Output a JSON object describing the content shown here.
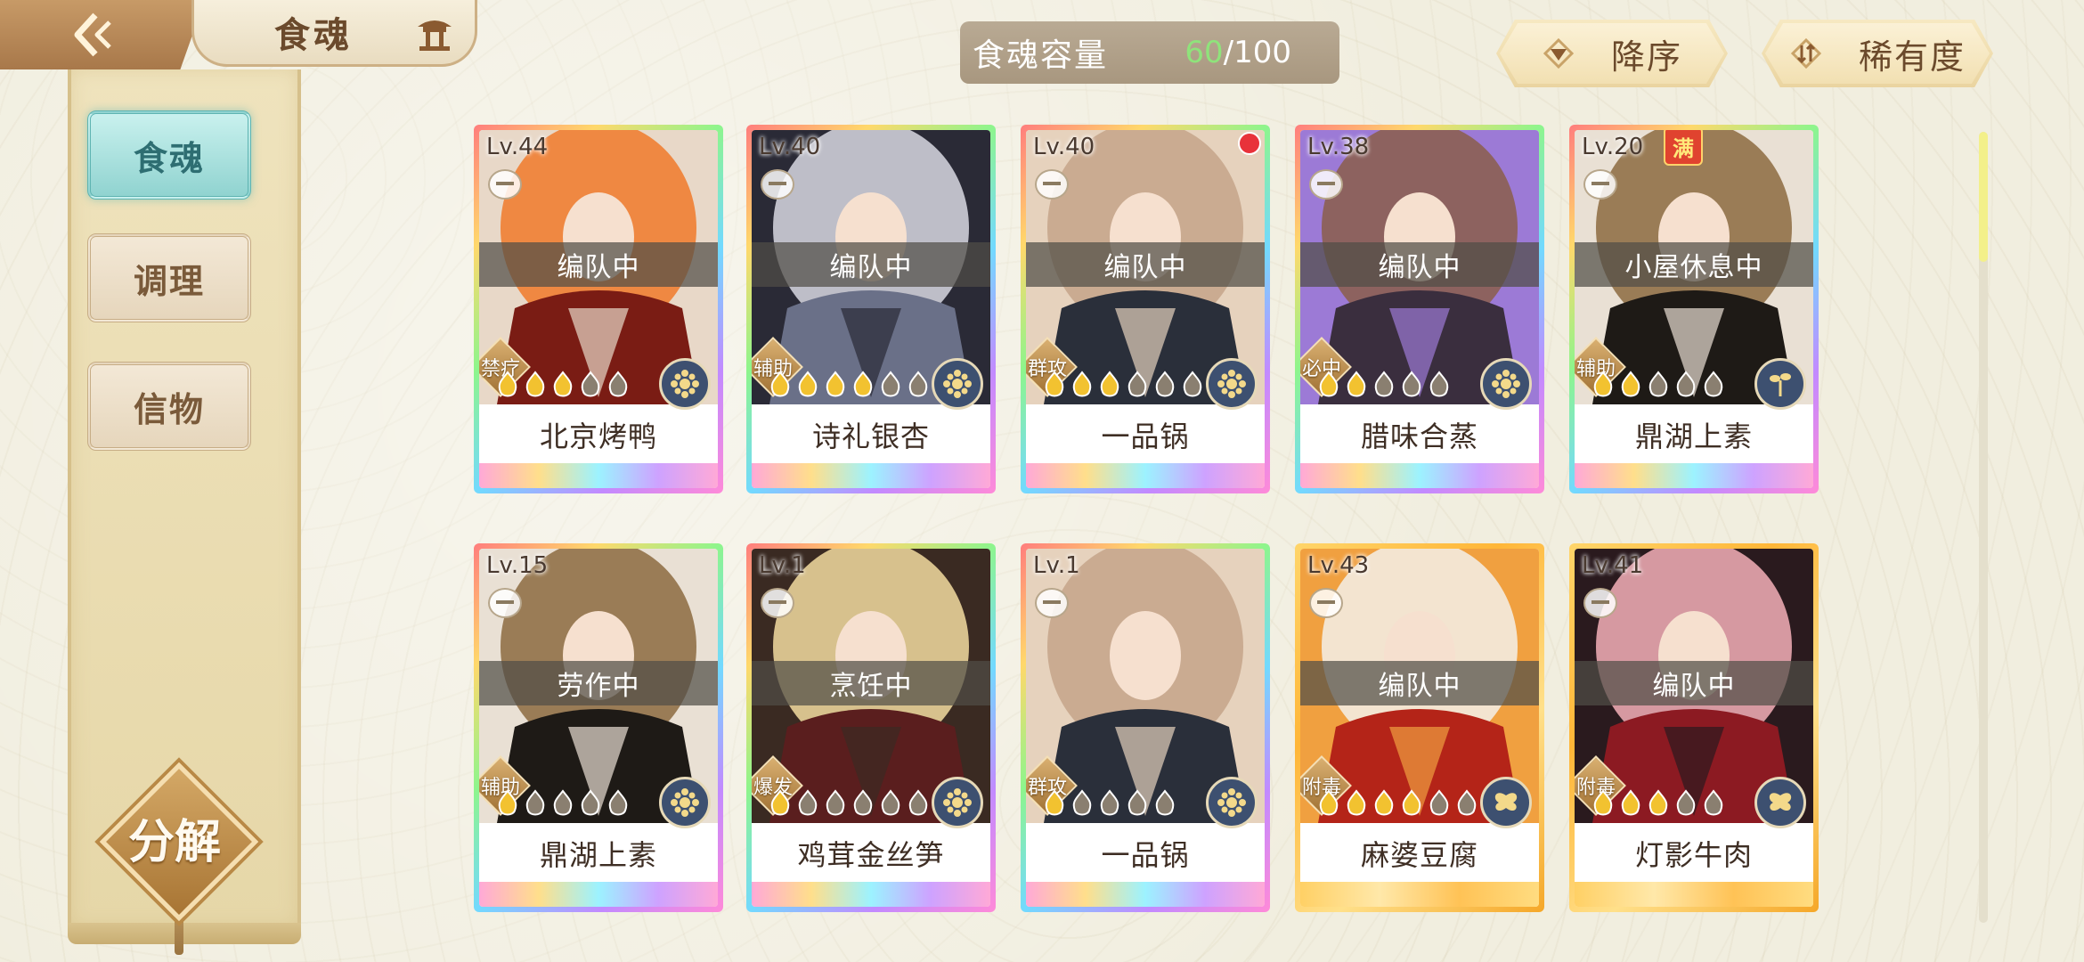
{
  "header": {
    "title": "食魂"
  },
  "sidebar": {
    "tabs": [
      {
        "label": "食魂",
        "active": true
      },
      {
        "label": "调理",
        "active": false
      },
      {
        "label": "信物",
        "active": false
      }
    ],
    "decompose_label": "分解"
  },
  "topbar": {
    "capacity_label": "食魂容量",
    "capacity_current": "60",
    "capacity_max": "/100",
    "sort_order_label": "降序",
    "sort_by_label": "稀有度"
  },
  "colors": {
    "active_tab": "#90d3d0",
    "accent_gold": "#c9a368",
    "capacity_current": "#8fe37b",
    "status_bar": "#504e46"
  },
  "cards": [
    {
      "level": "Lv.44",
      "status": "编队中",
      "role": "禁疗",
      "name": "北京烤鸭",
      "stars_filled": 3,
      "stars_total": 5,
      "element_icon": "flower-icon",
      "frame": "rainbow",
      "badge": "",
      "palette": [
        "#7a1c14",
        "#f07a2a",
        "#e8d8c8"
      ]
    },
    {
      "level": "Lv.40",
      "status": "编队中",
      "role": "辅助",
      "name": "诗礼银杏",
      "stars_filled": 4,
      "stars_total": 6,
      "element_icon": "flower-icon",
      "frame": "rainbow",
      "badge": "",
      "palette": [
        "#6a7088",
        "#d8d8e2",
        "#2a2a36"
      ]
    },
    {
      "level": "Lv.40",
      "status": "编队中",
      "role": "群攻",
      "name": "一品锅",
      "stars_filled": 3,
      "stars_total": 6,
      "element_icon": "flower-icon",
      "frame": "rainbow",
      "badge": "dot",
      "palette": [
        "#2a2f3a",
        "#c4a48a",
        "#e6d2bd"
      ]
    },
    {
      "level": "Lv.38",
      "status": "编队中",
      "role": "必中",
      "name": "腊味合蒸",
      "stars_filled": 2,
      "stars_total": 5,
      "element_icon": "flower-icon",
      "frame": "rainbow",
      "badge": "",
      "palette": [
        "#3a2e3e",
        "#8b5e4a",
        "#9c7ad6"
      ]
    },
    {
      "level": "Lv.20",
      "status": "小屋休息中",
      "role": "辅助",
      "name": "鼎湖上素",
      "stars_filled": 2,
      "stars_total": 5,
      "element_icon": "sprout-icon",
      "frame": "rainbow",
      "badge": "满",
      "palette": [
        "#1e1a16",
        "#8c6a40",
        "#e9e0d4"
      ]
    },
    {
      "level": "Lv.15",
      "status": "劳作中",
      "role": "辅助",
      "name": "鼎湖上素",
      "stars_filled": 1,
      "stars_total": 5,
      "element_icon": "flower-icon",
      "frame": "rainbow",
      "badge": "",
      "palette": [
        "#1e1a16",
        "#8c6a40",
        "#e9e0d4"
      ]
    },
    {
      "level": "Lv.1",
      "status": "烹饪中",
      "role": "爆发",
      "name": "鸡茸金丝笋",
      "stars_filled": 1,
      "stars_total": 6,
      "element_icon": "flower-icon",
      "frame": "rainbow",
      "badge": "",
      "palette": [
        "#5a1e1e",
        "#f3dca0",
        "#3a2a22"
      ]
    },
    {
      "level": "Lv.1",
      "status": "",
      "role": "群攻",
      "name": "一品锅",
      "stars_filled": 1,
      "stars_total": 5,
      "element_icon": "flower-icon",
      "frame": "rainbow",
      "badge": "",
      "palette": [
        "#2a2f3a",
        "#c4a48a",
        "#e6d2bd"
      ]
    },
    {
      "level": "Lv.43",
      "status": "编队中",
      "role": "附毒",
      "name": "麻婆豆腐",
      "stars_filled": 4,
      "stars_total": 6,
      "element_icon": "butterfly-icon",
      "frame": "gold",
      "badge": "",
      "palette": [
        "#b42418",
        "#f3f0ea",
        "#f0a040"
      ]
    },
    {
      "level": "Lv.41",
      "status": "编队中",
      "role": "附毒",
      "name": "灯影牛肉",
      "stars_filled": 3,
      "stars_total": 5,
      "element_icon": "butterfly-icon",
      "frame": "gold",
      "badge": "",
      "palette": [
        "#8c1a22",
        "#f4b0b8",
        "#2a1a1e"
      ]
    }
  ]
}
